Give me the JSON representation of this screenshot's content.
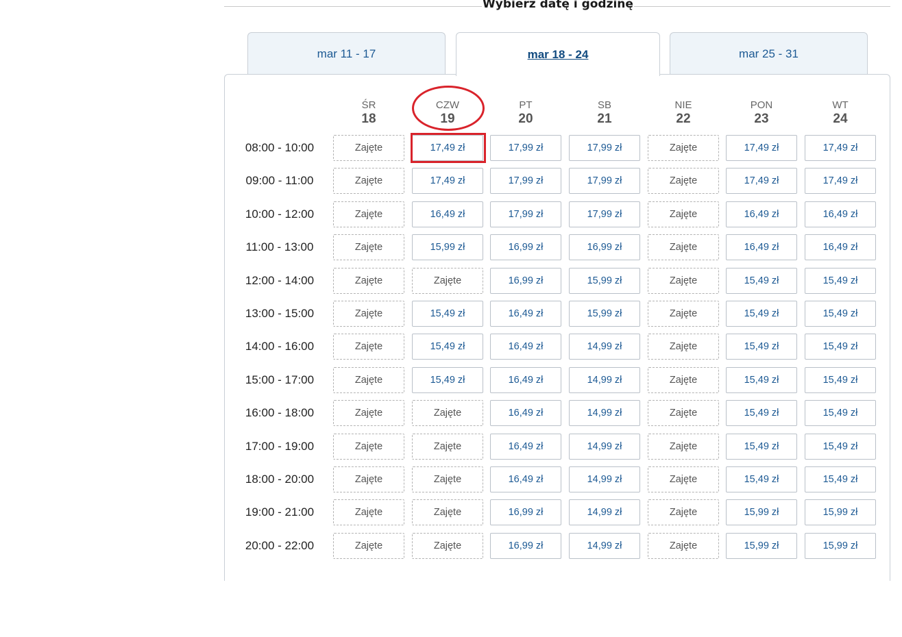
{
  "section": {
    "title": "Wybierz datę i godzinę"
  },
  "tabs": [
    {
      "label": "mar 11 - 17",
      "active": false
    },
    {
      "label": "mar 18 - 24",
      "active": true
    },
    {
      "label": "mar 25 - 31",
      "active": false
    }
  ],
  "days": [
    {
      "name": "ŚR",
      "num": "18"
    },
    {
      "name": "CZW",
      "num": "19"
    },
    {
      "name": "PT",
      "num": "20"
    },
    {
      "name": "SB",
      "num": "21"
    },
    {
      "name": "NIE",
      "num": "22"
    },
    {
      "name": "PON",
      "num": "23"
    },
    {
      "name": "WT",
      "num": "24"
    }
  ],
  "taken_label": "Zajęte",
  "slots": [
    {
      "time": "08:00 - 10:00",
      "cells": [
        "Zajęte",
        "17,49 zł",
        "17,99 zł",
        "17,99 zł",
        "Zajęte",
        "17,49 zł",
        "17,49 zł"
      ]
    },
    {
      "time": "09:00 - 11:00",
      "cells": [
        "Zajęte",
        "17,49 zł",
        "17,99 zł",
        "17,99 zł",
        "Zajęte",
        "17,49 zł",
        "17,49 zł"
      ]
    },
    {
      "time": "10:00 - 12:00",
      "cells": [
        "Zajęte",
        "16,49 zł",
        "17,99 zł",
        "17,99 zł",
        "Zajęte",
        "16,49 zł",
        "16,49 zł"
      ]
    },
    {
      "time": "11:00 - 13:00",
      "cells": [
        "Zajęte",
        "15,99 zł",
        "16,99 zł",
        "16,99 zł",
        "Zajęte",
        "16,49 zł",
        "16,49 zł"
      ]
    },
    {
      "time": "12:00 - 14:00",
      "cells": [
        "Zajęte",
        "Zajęte",
        "16,99 zł",
        "15,99 zł",
        "Zajęte",
        "15,49 zł",
        "15,49 zł"
      ]
    },
    {
      "time": "13:00 - 15:00",
      "cells": [
        "Zajęte",
        "15,49 zł",
        "16,49 zł",
        "15,99 zł",
        "Zajęte",
        "15,49 zł",
        "15,49 zł"
      ]
    },
    {
      "time": "14:00 - 16:00",
      "cells": [
        "Zajęte",
        "15,49 zł",
        "16,49 zł",
        "14,99 zł",
        "Zajęte",
        "15,49 zł",
        "15,49 zł"
      ]
    },
    {
      "time": "15:00 - 17:00",
      "cells": [
        "Zajęte",
        "15,49 zł",
        "16,49 zł",
        "14,99 zł",
        "Zajęte",
        "15,49 zł",
        "15,49 zł"
      ]
    },
    {
      "time": "16:00 - 18:00",
      "cells": [
        "Zajęte",
        "Zajęte",
        "16,49 zł",
        "14,99 zł",
        "Zajęte",
        "15,49 zł",
        "15,49 zł"
      ]
    },
    {
      "time": "17:00 - 19:00",
      "cells": [
        "Zajęte",
        "Zajęte",
        "16,49 zł",
        "14,99 zł",
        "Zajęte",
        "15,49 zł",
        "15,49 zł"
      ]
    },
    {
      "time": "18:00 - 20:00",
      "cells": [
        "Zajęte",
        "Zajęte",
        "16,49 zł",
        "14,99 zł",
        "Zajęte",
        "15,49 zł",
        "15,49 zł"
      ]
    },
    {
      "time": "19:00 - 21:00",
      "cells": [
        "Zajęte",
        "Zajęte",
        "16,99 zł",
        "14,99 zł",
        "Zajęte",
        "15,99 zł",
        "15,99 zł"
      ]
    },
    {
      "time": "20:00 - 22:00",
      "cells": [
        "Zajęte",
        "Zajęte",
        "16,99 zł",
        "14,99 zł",
        "Zajęte",
        "15,99 zł",
        "15,99 zł"
      ]
    }
  ],
  "colors": {
    "link": "#1d5a94",
    "annotation": "#d9232b",
    "border": "#c9cfd6"
  }
}
